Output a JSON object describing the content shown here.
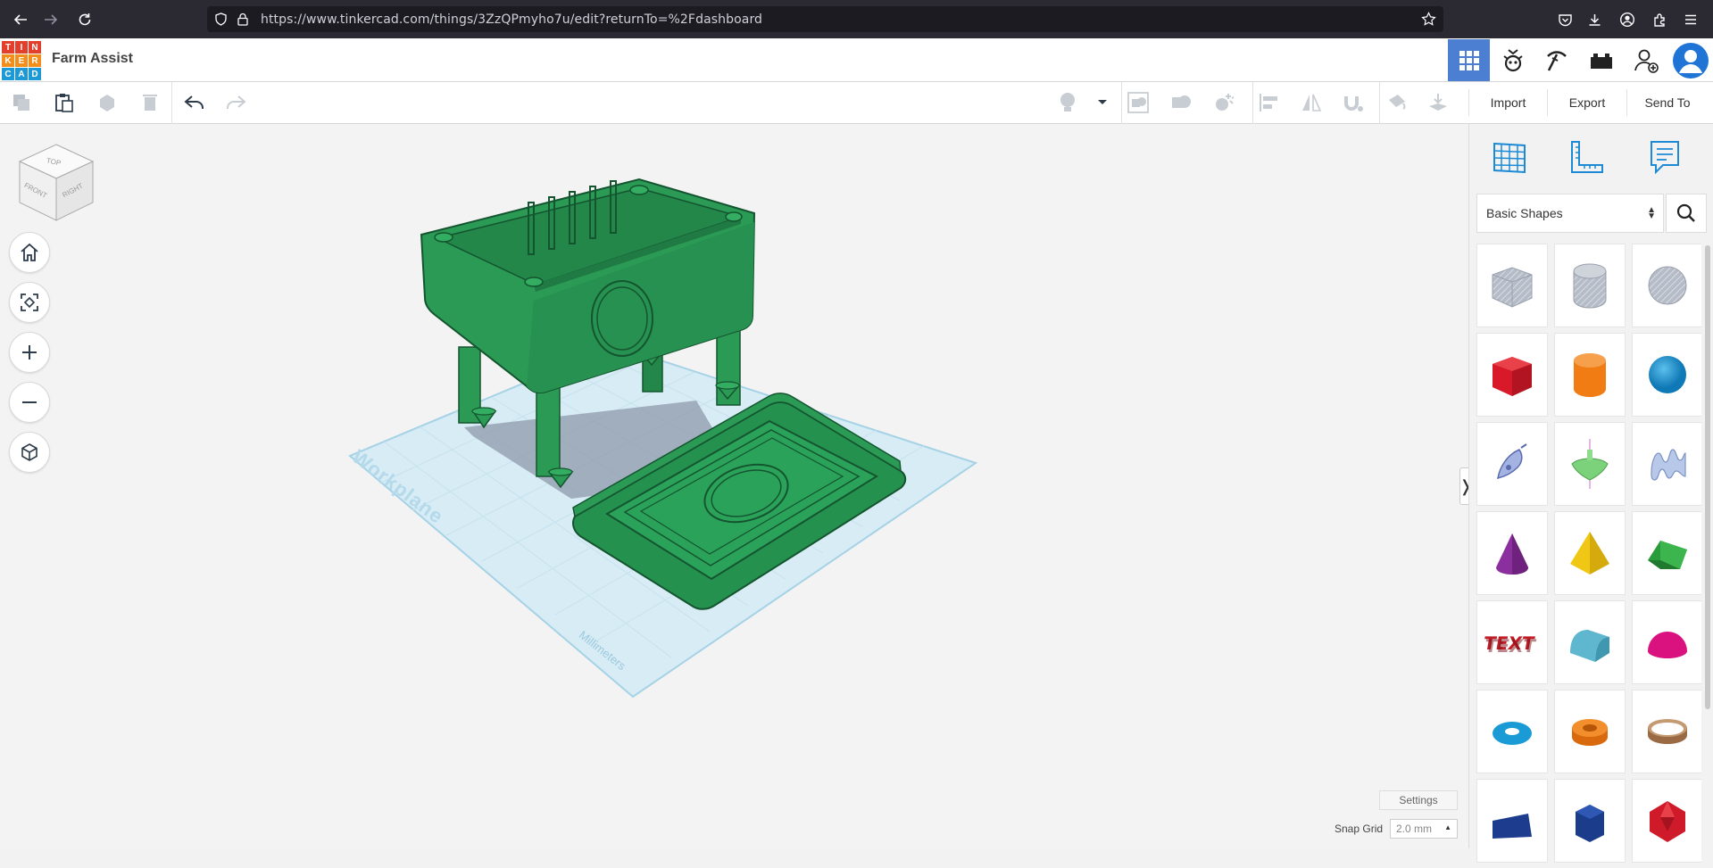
{
  "browser": {
    "url": "https://www.tinkercad.com/things/3ZzQPmyho7u/edit?returnTo=%2Fdashboard"
  },
  "app": {
    "logo_letters": [
      "T",
      "I",
      "N",
      "K",
      "E",
      "R",
      "C",
      "A",
      "D"
    ],
    "logo_colors": [
      "#e2402c",
      "#e2402c",
      "#e2402c",
      "#f28e1b",
      "#f28e1b",
      "#f28e1b",
      "#1d9ad6",
      "#1d9ad6",
      "#1d9ad6"
    ],
    "project_title": "Farm Assist"
  },
  "header_icons": [
    "grid-view-icon",
    "tinker-lab-icon",
    "pickaxe-icon",
    "bricks-icon",
    "add-user-icon",
    "avatar-icon"
  ],
  "toolbar": {
    "left_icons": [
      "copy-icon",
      "paste-icon",
      "duplicate-icon",
      "delete-icon",
      "undo-icon",
      "redo-icon"
    ],
    "right_icons": [
      "light-bulb-icon",
      "dropdown-caret-icon",
      "group-icon",
      "ungroup-icon",
      "solid-hole-icon",
      "align-icon",
      "mirror-icon",
      "cruise-icon",
      "paint-icon",
      "workplane-drop-icon"
    ]
  },
  "right_toolbar": {
    "import_label": "Import",
    "export_label": "Export",
    "send_to_label": "Send To"
  },
  "viewcube": {
    "top": "TOP",
    "front": "FRONT",
    "right": "RIGHT"
  },
  "view_controls": [
    "home-view-icon",
    "fit-all-icon",
    "zoom-in-icon",
    "zoom-out-icon",
    "perspective-icon"
  ],
  "workplane": {
    "label": "Workplane",
    "units": "Millimeters"
  },
  "footer": {
    "settings_label": "Settings",
    "snap_grid_label": "Snap Grid",
    "snap_grid_value": "2.0 mm"
  },
  "panel": {
    "tools": [
      "workplane-grid-icon",
      "ruler-icon",
      "notes-icon"
    ],
    "category": "Basic Shapes",
    "shapes": [
      {
        "name": "box-hole",
        "color": "#a9b0bc"
      },
      {
        "name": "cylinder-hole",
        "color": "#b0b6c2"
      },
      {
        "name": "sphere-hole",
        "color": "#aeb4c0"
      },
      {
        "name": "box",
        "color": "#d7192a"
      },
      {
        "name": "cylinder",
        "color": "#f07c13"
      },
      {
        "name": "sphere",
        "color": "#1a8fcf"
      },
      {
        "name": "scribble",
        "color": "#7f8fcf"
      },
      {
        "name": "spinning-top",
        "color": "#7bd27a"
      },
      {
        "name": "shape-generator",
        "color": "#9cb1d9"
      },
      {
        "name": "cone",
        "color": "#8c2f9e"
      },
      {
        "name": "pyramid",
        "color": "#f1c716"
      },
      {
        "name": "roof",
        "color": "#2a9c3c"
      },
      {
        "name": "text",
        "color": "#c21d26"
      },
      {
        "name": "round-roof",
        "color": "#5fb7cf"
      },
      {
        "name": "half-sphere",
        "color": "#d9127f"
      },
      {
        "name": "torus",
        "color": "#1a9bd6"
      },
      {
        "name": "tube",
        "color": "#ee7c17"
      },
      {
        "name": "ring",
        "color": "#b08057"
      },
      {
        "name": "wedge",
        "color": "#1d3c8d"
      },
      {
        "name": "polygon",
        "color": "#1a3c8a"
      },
      {
        "name": "icosahedron",
        "color": "#cf1a2a"
      }
    ]
  }
}
